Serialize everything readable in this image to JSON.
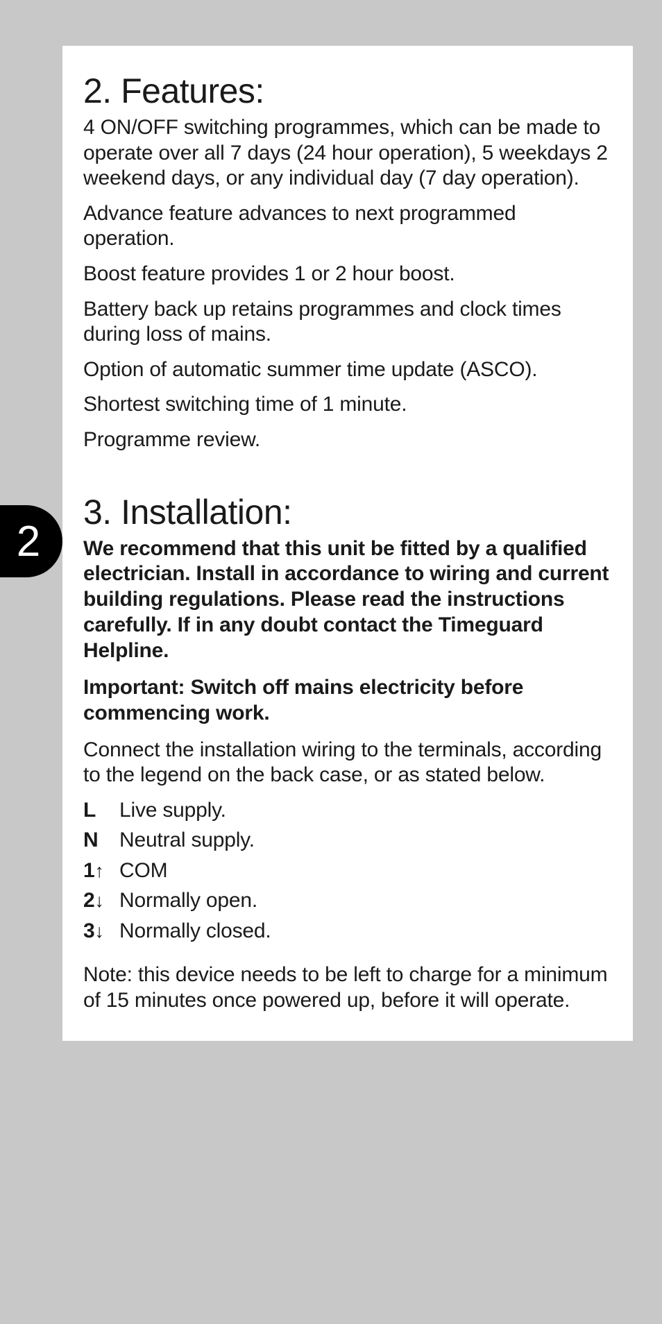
{
  "page_number": "2",
  "features": {
    "heading": "2. Features:",
    "items": [
      "4 ON/OFF switching programmes, which can be made to operate over all 7 days (24 hour operation), 5 weekdays 2 weekend days, or any individual day (7 day operation).",
      "Advance feature advances to next programmed operation.",
      "Boost feature provides 1 or 2 hour boost.",
      "Battery back up retains programmes and clock times during loss of mains.",
      "Option of automatic summer time update (ASCO).",
      "Shortest switching time of 1 minute.",
      "Programme review."
    ]
  },
  "installation": {
    "heading": "3. Installation:",
    "recommendation": "We recommend that this unit be fitted by a qualified electrician. Install in accordance to wiring and current building regulations. Please read the instructions carefully. If in any doubt contact the Timeguard Helpline.",
    "important": "Important: Switch off mains electricity before commencing work.",
    "connect_text": "Connect the installation wiring to the terminals, according to the legend on the back case, or as stated below.",
    "terminals": [
      {
        "label": "L",
        "arrow": "",
        "desc": "Live supply."
      },
      {
        "label": "N",
        "arrow": "",
        "desc": "Neutral supply."
      },
      {
        "label": "1",
        "arrow": "↑",
        "desc": "COM"
      },
      {
        "label": "2",
        "arrow": "↓",
        "desc": "Normally open."
      },
      {
        "label": "3",
        "arrow": "↓",
        "desc": "Normally closed."
      }
    ],
    "note": "Note: this device needs to be left to charge for a minimum of 15 minutes once powered up, before it will operate."
  }
}
